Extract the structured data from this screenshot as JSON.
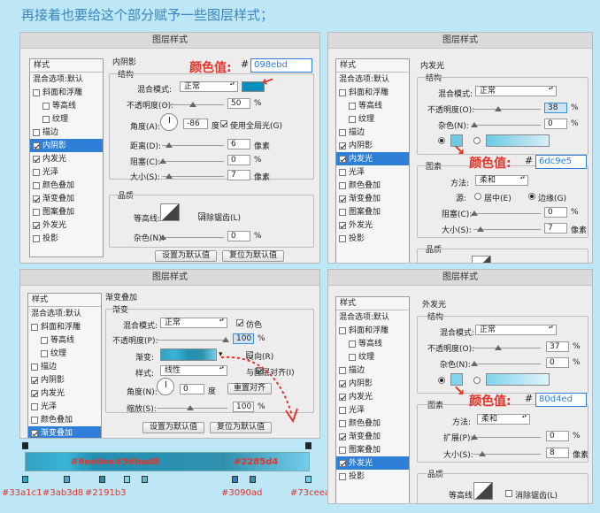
{
  "heading": "再接着也要给这个部分赋予一些图层样式；",
  "dialog_title": "图层样式",
  "color_label": "颜色值",
  "style_header": "样式",
  "blend_default": "混合选项:默认",
  "structure": "结构",
  "quality": "品质",
  "units": {
    "percent": "%",
    "px": "像素",
    "deg": "度"
  },
  "labels": {
    "blend_mode": "混合模式:",
    "opacity": "不透明度(O):",
    "opacity_p": "不透明度(P):",
    "angle": "角度(A):",
    "angle_n": "角度(N):",
    "distance": "距离(D):",
    "choke": "阻塞(C):",
    "size": "大小(S):",
    "contour": "等高线:",
    "antialias": "消除锯齿(L)",
    "noise": "杂色(N):",
    "global_light": "使用全局光(G)",
    "set_default": "设置为默认值",
    "reset_default": "复位为默认值",
    "elements": "图素",
    "method": "方法:",
    "source": "源:",
    "center": "居中(E)",
    "edge": "边缘(G)",
    "spread": "扩展(P):",
    "gradient": "渐变",
    "gradient_c": "渐变:",
    "style_l": "样式:",
    "dither": "仿色",
    "reverse": "反向(R)",
    "align_layer": "与图层对齐(I)",
    "reset_align": "重置对齐",
    "scale": "缩放(S):"
  },
  "values": {
    "normal": "正常",
    "softer": "柔和",
    "linear": "线性"
  },
  "panel1": {
    "section": "内阴影",
    "hex": "098ebd",
    "swatch": "#098ebd",
    "opacity": "50",
    "angle": "-86",
    "distance": "6",
    "choke": "0",
    "size": "7",
    "noise": "0",
    "items": [
      {
        "label": "斜面和浮雕",
        "checked": false
      },
      {
        "label": "等高线",
        "checked": false,
        "indent": true
      },
      {
        "label": "纹理",
        "checked": false,
        "indent": true
      },
      {
        "label": "描边",
        "checked": false
      },
      {
        "label": "内阴影",
        "checked": true,
        "selected": true
      },
      {
        "label": "内发光",
        "checked": true
      },
      {
        "label": "光泽",
        "checked": false
      },
      {
        "label": "颜色叠加",
        "checked": false
      },
      {
        "label": "渐变叠加",
        "checked": true
      },
      {
        "label": "图案叠加",
        "checked": false
      },
      {
        "label": "外发光",
        "checked": true
      },
      {
        "label": "投影",
        "checked": false
      }
    ]
  },
  "panel2": {
    "section": "内发光",
    "hex": "6dc9e5",
    "swatch": "#6dc9e5",
    "opacity": "38",
    "noise": "0",
    "choke": "0",
    "size": "7",
    "items": [
      {
        "label": "斜面和浮雕",
        "checked": false
      },
      {
        "label": "等高线",
        "checked": false,
        "indent": true
      },
      {
        "label": "纹理",
        "checked": false,
        "indent": true
      },
      {
        "label": "描边",
        "checked": false
      },
      {
        "label": "内阴影",
        "checked": true
      },
      {
        "label": "内发光",
        "checked": true,
        "selected": true
      },
      {
        "label": "光泽",
        "checked": false
      },
      {
        "label": "颜色叠加",
        "checked": false
      },
      {
        "label": "渐变叠加",
        "checked": true
      },
      {
        "label": "图案叠加",
        "checked": false
      },
      {
        "label": "外发光",
        "checked": true
      },
      {
        "label": "投影",
        "checked": false
      }
    ]
  },
  "panel3": {
    "section": "渐变叠加",
    "opacity": "100",
    "angle": "0",
    "scale": "100",
    "items": [
      {
        "label": "斜面和浮雕",
        "checked": false
      },
      {
        "label": "等高线",
        "checked": false,
        "indent": true
      },
      {
        "label": "纹理",
        "checked": false,
        "indent": true
      },
      {
        "label": "描边",
        "checked": false
      },
      {
        "label": "内阴影",
        "checked": true
      },
      {
        "label": "内发光",
        "checked": true
      },
      {
        "label": "光泽",
        "checked": false
      },
      {
        "label": "颜色叠加",
        "checked": false
      },
      {
        "label": "渐变叠加",
        "checked": true,
        "selected": true
      }
    ]
  },
  "panel4": {
    "section": "外发光",
    "hex": "80d4ed",
    "swatch": "#80d4ed",
    "opacity": "37",
    "noise": "0",
    "spread": "0",
    "size": "8",
    "items": [
      {
        "label": "斜面和浮雕",
        "checked": false
      },
      {
        "label": "等高线",
        "checked": false,
        "indent": true
      },
      {
        "label": "纹理",
        "checked": false,
        "indent": true
      },
      {
        "label": "描边",
        "checked": false
      },
      {
        "label": "内阴影",
        "checked": true
      },
      {
        "label": "内发光",
        "checked": true
      },
      {
        "label": "光泽",
        "checked": false
      },
      {
        "label": "颜色叠加",
        "checked": false
      },
      {
        "label": "渐变叠加",
        "checked": true
      },
      {
        "label": "图案叠加",
        "checked": false
      },
      {
        "label": "外发光",
        "checked": true,
        "selected": true
      },
      {
        "label": "投影",
        "checked": false
      }
    ]
  },
  "gradient_bar": {
    "top_colors": [
      "#6ee0ee",
      "#56bad8",
      "#2285d4"
    ],
    "bottom_colors": [
      "#33a1c1",
      "#3ab3d8",
      "#2191b3",
      "#3090ad",
      "#73ceea"
    ]
  }
}
